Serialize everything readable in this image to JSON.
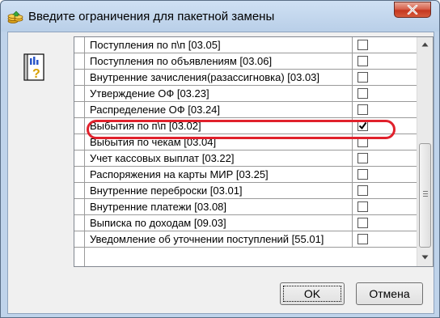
{
  "window": {
    "title": "Введите ограничения для пакетной замены",
    "close_glyph": "x"
  },
  "icons": {
    "title_icon": "coins-stack-icon",
    "help_icon": "help-book-icon",
    "checkmark": "checkmark-icon"
  },
  "list": {
    "rows": [
      {
        "label": "Поступления по п\\п [03.05]",
        "checked": false
      },
      {
        "label": "Поступления по объявлениям [03.06]",
        "checked": false
      },
      {
        "label": "Внутренние зачисления(разассигновка) [03.03]",
        "checked": false
      },
      {
        "label": "Утверждение ОФ [03.23]",
        "checked": false
      },
      {
        "label": "Распределение ОФ [03.24]",
        "checked": false
      },
      {
        "label": "Выбытия по п\\п [03.02]",
        "checked": true,
        "selected": true
      },
      {
        "label": "Выбытия по чекам [03.04]",
        "checked": false
      },
      {
        "label": "Учет кассовых выплат [03.22]",
        "checked": false
      },
      {
        "label": "Распоряжения на карты МИР [03.25]",
        "checked": false
      },
      {
        "label": "Внутренние переброски [03.01]",
        "checked": false
      },
      {
        "label": "Внутренние платежи [03.08]",
        "checked": false
      },
      {
        "label": "Выписка по доходам [09.03]",
        "checked": false
      },
      {
        "label": "Уведомление об уточнении поступлений [55.01]",
        "checked": false
      }
    ]
  },
  "buttons": {
    "ok": "OK",
    "cancel": "Отмена"
  },
  "colors": {
    "highlight_ring": "#e0212c",
    "title_bar": "#bfd3ea"
  }
}
